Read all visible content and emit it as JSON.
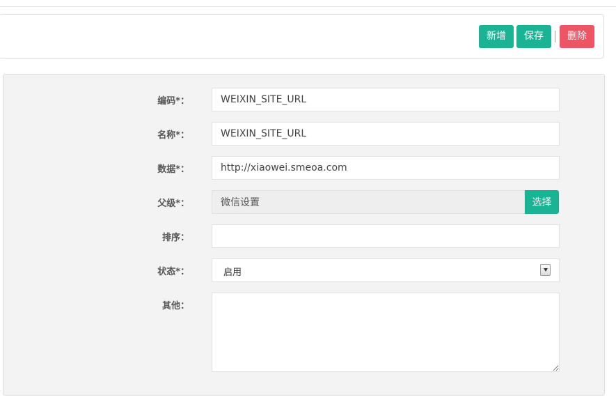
{
  "toolbar": {
    "add_label": "新增",
    "save_label": "保存",
    "delete_label": "删除"
  },
  "form": {
    "code": {
      "label": "编码*：",
      "value": "WEIXIN_SITE_URL"
    },
    "name": {
      "label": "名称*：",
      "value": "WEIXIN_SITE_URL"
    },
    "data": {
      "label": "数据*：",
      "value": "http://xiaowei.smeoa.com"
    },
    "parent": {
      "label": "父级*：",
      "value": "微信设置",
      "button_label": "选择"
    },
    "sort": {
      "label": "排序：",
      "value": ""
    },
    "status": {
      "label": "状态*：",
      "selected": "启用"
    },
    "other": {
      "label": "其他：",
      "value": ""
    }
  },
  "colors": {
    "primary": "#1ab394",
    "danger": "#ed5565",
    "panel_bg": "#f3f3f4"
  },
  "icons": {
    "select_arrow": "chevron-down-icon"
  }
}
